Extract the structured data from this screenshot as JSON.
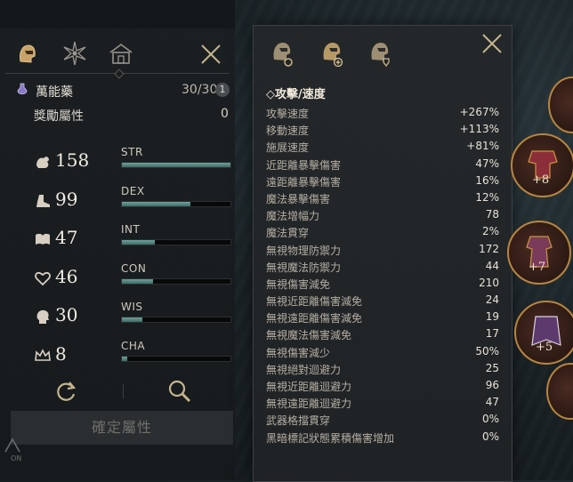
{
  "tabs": [
    {
      "name": "helmet-icon"
    },
    {
      "name": "star-compass-icon"
    },
    {
      "name": "house-icon"
    }
  ],
  "potion": {
    "label": "萬能藥",
    "count": "30/30",
    "badge": "1"
  },
  "bonus": {
    "label": "獎勵屬性",
    "value": "0"
  },
  "stats": [
    {
      "value": "158",
      "name": "STR",
      "fill": 1.0,
      "icon": "muscle-icon"
    },
    {
      "value": "99",
      "name": "DEX",
      "fill": 0.63,
      "icon": "boot-icon"
    },
    {
      "value": "47",
      "name": "INT",
      "fill": 0.3,
      "icon": "book-icon"
    },
    {
      "value": "46",
      "name": "CON",
      "fill": 0.29,
      "icon": "heart-icon"
    },
    {
      "value": "30",
      "name": "WIS",
      "fill": 0.19,
      "icon": "head-icon"
    },
    {
      "value": "8",
      "name": "CHA",
      "fill": 0.05,
      "icon": "crown-icon"
    }
  ],
  "actions": {
    "reset_icon": "refresh-icon",
    "inspect_icon": "magnifier-icon"
  },
  "confirm_label": "確定屬性",
  "tooltip": {
    "title": "◇攻擊/速度",
    "lines": [
      {
        "label": "攻擊速度",
        "value": "+267%"
      },
      {
        "label": "移動速度",
        "value": "+113%"
      },
      {
        "label": "施展速度",
        "value": "+81%"
      },
      {
        "label": "近距離暴擊傷害",
        "value": "47%"
      },
      {
        "label": "遠距離暴擊傷害",
        "value": "16%"
      },
      {
        "label": "魔法暴擊傷害",
        "value": "12%"
      },
      {
        "label": "魔法增幅力",
        "value": "78"
      },
      {
        "label": "魔法貫穿",
        "value": "2%"
      },
      {
        "label": "無視物理防禦力",
        "value": "172"
      },
      {
        "label": "無視魔法防禦力",
        "value": "44"
      },
      {
        "label": "無視傷害減免",
        "value": "210"
      },
      {
        "label": "無視近距離傷害減免",
        "value": "24"
      },
      {
        "label": "無視遠距離傷害減免",
        "value": "19"
      },
      {
        "label": "無視魔法傷害減免",
        "value": "17"
      },
      {
        "label": "無視傷害減少",
        "value": "50%"
      },
      {
        "label": "無視絕對迴避力",
        "value": "25"
      },
      {
        "label": "無視近距離迴避力",
        "value": "96"
      },
      {
        "label": "無視遠距離迴避力",
        "value": "47"
      },
      {
        "label": "武器格擋貫穿",
        "value": "0%"
      },
      {
        "label": "黑暗標記狀態累積傷害增加",
        "value": "0%"
      }
    ]
  },
  "side_items": [
    {
      "plus": "+8"
    },
    {
      "plus": "+7"
    },
    {
      "plus": "+5"
    }
  ],
  "colors": {
    "accent": "#6fa19a",
    "gold": "#b8853e",
    "panel": "#1b1f22"
  }
}
